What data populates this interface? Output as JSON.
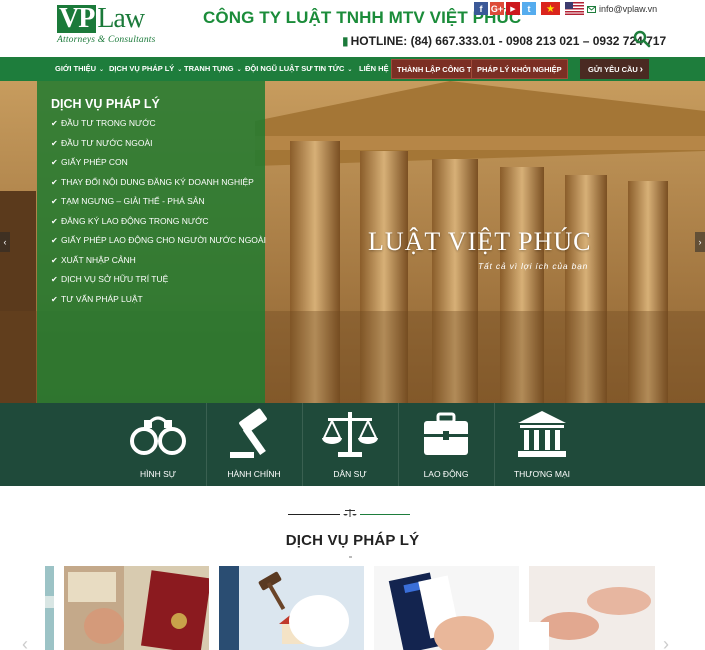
{
  "header": {
    "logo_vp": "VP",
    "logo_law": "Law",
    "logo_sub": "Attorneys & Consultants",
    "company_name": "CÔNG TY LUẬT TNHH  MTV VIỆT PHÚC",
    "hotline": "HOTLINE: (84) 667.333.01 - 0908 213 021 – 0932 724 717",
    "email": "info@vplaw.vn",
    "socials": [
      "f",
      "G+",
      "▶",
      "t"
    ]
  },
  "nav": {
    "items": [
      {
        "label": "GIỚI THIỆU",
        "has_dropdown": true
      },
      {
        "label": "DỊCH VỤ PHÁP LÝ",
        "has_dropdown": true
      },
      {
        "label": "TRANH TỤNG",
        "has_dropdown": true
      },
      {
        "label": "ĐỘI NGŨ LUẬT SƯ",
        "has_dropdown": false
      },
      {
        "label": "TIN TỨC",
        "has_dropdown": true
      },
      {
        "label": "LIÊN HỆ",
        "has_dropdown": false
      }
    ],
    "special_1": "THÀNH LẬP CÔNG TY",
    "special_2": "PHÁP LÝ KHỞI NGHIỆP",
    "request": "GỬI YÊU CẦU"
  },
  "hero": {
    "panel_title": "DỊCH VỤ PHÁP LÝ",
    "services": [
      "ĐẦU TƯ TRONG NƯỚC",
      "ĐẦU TƯ NƯỚC NGOÀI",
      "GIẤY PHÉP CON",
      "THAY ĐỔI NỘI DUNG ĐĂNG KÝ DOANH NGHIỆP",
      "TẠM NGƯNG – GIẢI THỂ - PHÁ SẢN",
      "ĐĂNG KÝ LAO ĐỘNG TRONG NƯỚC",
      "GIẤY PHÉP LAO ĐỘNG CHO NGƯỜI NƯỚC NGOÀI",
      "XUẤT NHẬP CẢNH",
      "DỊCH VỤ SỞ HỮU TRÍ TUỆ",
      "TƯ VẤN PHÁP LUẬT"
    ],
    "brand": "LUẬT VIỆT PHÚC",
    "tagline": "Tất cả vì lợi ích của bạn"
  },
  "categories": [
    {
      "label": "HÌNH SỰ",
      "icon": "handcuffs-icon"
    },
    {
      "label": "HÀNH CHÍNH",
      "icon": "gavel-icon"
    },
    {
      "label": "DÂN SỰ",
      "icon": "scales-icon"
    },
    {
      "label": "LAO ĐỘNG",
      "icon": "briefcase-icon"
    },
    {
      "label": "THƯƠNG MẠI",
      "icon": "courthouse-icon"
    }
  ],
  "services_section": {
    "title": "DỊCH VỤ PHÁP LÝ"
  },
  "colors": {
    "brand_green": "#1e7d3c",
    "nav_special": "#7b2f24",
    "category_bar": "#1f4a3a"
  }
}
